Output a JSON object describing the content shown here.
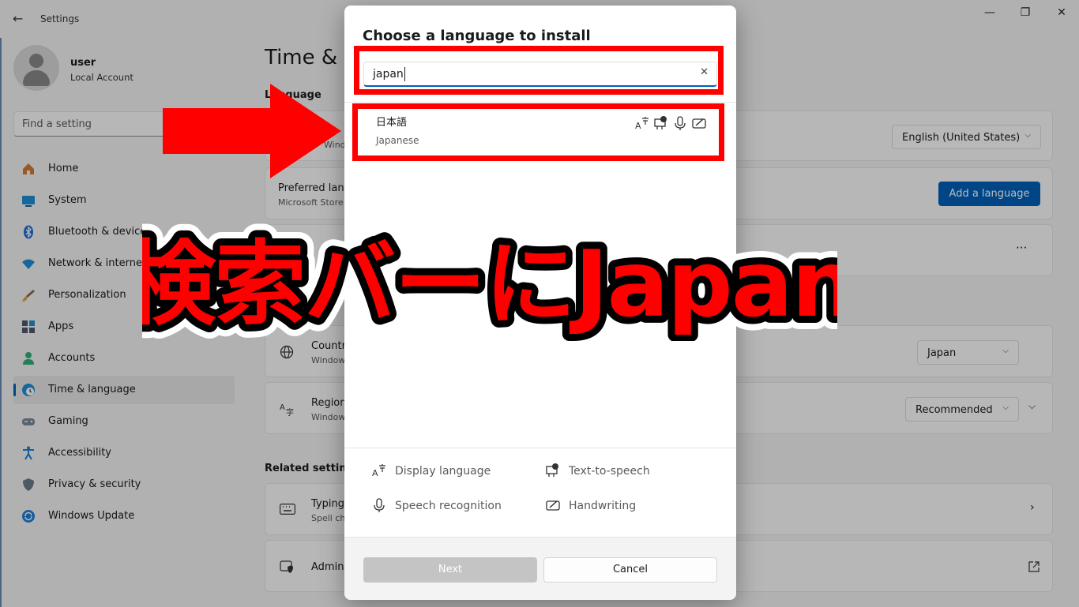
{
  "window": {
    "back_glyph": "←",
    "title": "Settings",
    "min_glyph": "—",
    "max_glyph": "❐",
    "close_glyph": "✕"
  },
  "user": {
    "name": "user",
    "account_type": "Local Account"
  },
  "search": {
    "placeholder": "Find a setting"
  },
  "sidebar": {
    "items": [
      {
        "label": "Home",
        "icon": "home-icon"
      },
      {
        "label": "System",
        "icon": "monitor-icon"
      },
      {
        "label": "Bluetooth & devices",
        "icon": "bluetooth-icon"
      },
      {
        "label": "Network & internet",
        "icon": "wifi-icon"
      },
      {
        "label": "Personalization",
        "icon": "brush-icon"
      },
      {
        "label": "Apps",
        "icon": "apps-icon"
      },
      {
        "label": "Accounts",
        "icon": "person-icon"
      },
      {
        "label": "Time & language",
        "icon": "clock-globe-icon"
      },
      {
        "label": "Gaming",
        "icon": "controller-icon"
      },
      {
        "label": "Accessibility",
        "icon": "accessibility-icon"
      },
      {
        "label": "Privacy & security",
        "icon": "shield-icon"
      },
      {
        "label": "Windows Update",
        "icon": "update-icon"
      }
    ],
    "active_index": 7
  },
  "main": {
    "page_title": "Time & l",
    "section_language": "Language",
    "display_lang": {
      "subtitle": "Window",
      "value": "English (United States)"
    },
    "preferred": {
      "title": "Preferred lang",
      "subtitle": "Microsoft Store",
      "button": "Add a language"
    },
    "more_glyph": "···",
    "country": {
      "title": "Countr",
      "subtitle": "Window",
      "value": "Japan"
    },
    "region": {
      "title": "Region",
      "subtitle": "Window",
      "value": "Recommended"
    },
    "related_settings": "Related settings",
    "typing": {
      "title": "Typing",
      "subtitle": "Spell ch"
    },
    "admin": {
      "title": "Admin"
    }
  },
  "dialog": {
    "title": "Choose a language to install",
    "search_value": "japan",
    "clear_glyph": "✕",
    "results": [
      {
        "native": "日本語",
        "english": "Japanese"
      }
    ],
    "legend": {
      "display_language": "Display language",
      "text_to_speech": "Text-to-speech",
      "speech_recognition": "Speech recognition",
      "handwriting": "Handwriting"
    },
    "next_label": "Next",
    "cancel_label": "Cancel"
  },
  "annotation": {
    "caption": "検索バーにJapan",
    "color": "#ff0000"
  },
  "colors": {
    "accent": "#005fb8",
    "annotation_red": "#ff0000"
  }
}
